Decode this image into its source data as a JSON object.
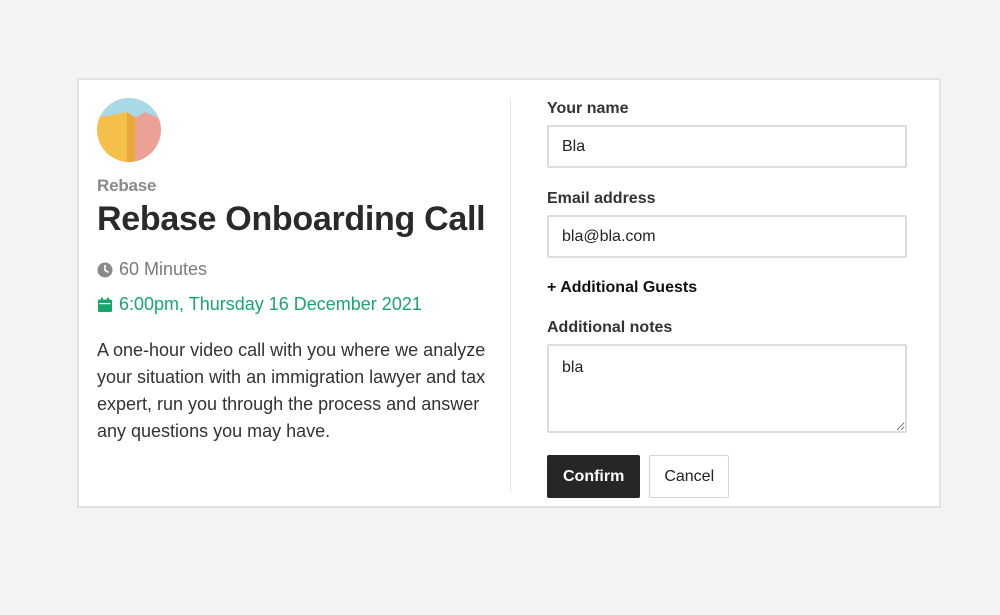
{
  "event": {
    "organization": "Rebase",
    "title": "Rebase Onboarding Call",
    "duration": "60 Minutes",
    "datetime": "6:00pm, Thursday 16 December 2021",
    "description": "A one-hour video call with you where we analyze your situation with an immigration lawyer and tax expert, run you through the process and answer any questions you may have.",
    "duration_icon": "clock-icon",
    "datetime_icon": "calendar-icon",
    "datetime_color": "#17a76b"
  },
  "form": {
    "name_label": "Your name",
    "name_value": "Bla",
    "email_label": "Email address",
    "email_value": "bla@bla.com",
    "guests_label": "+ Additional Guests",
    "notes_label": "Additional notes",
    "notes_value": "bla",
    "confirm_label": "Confirm",
    "cancel_label": "Cancel"
  }
}
